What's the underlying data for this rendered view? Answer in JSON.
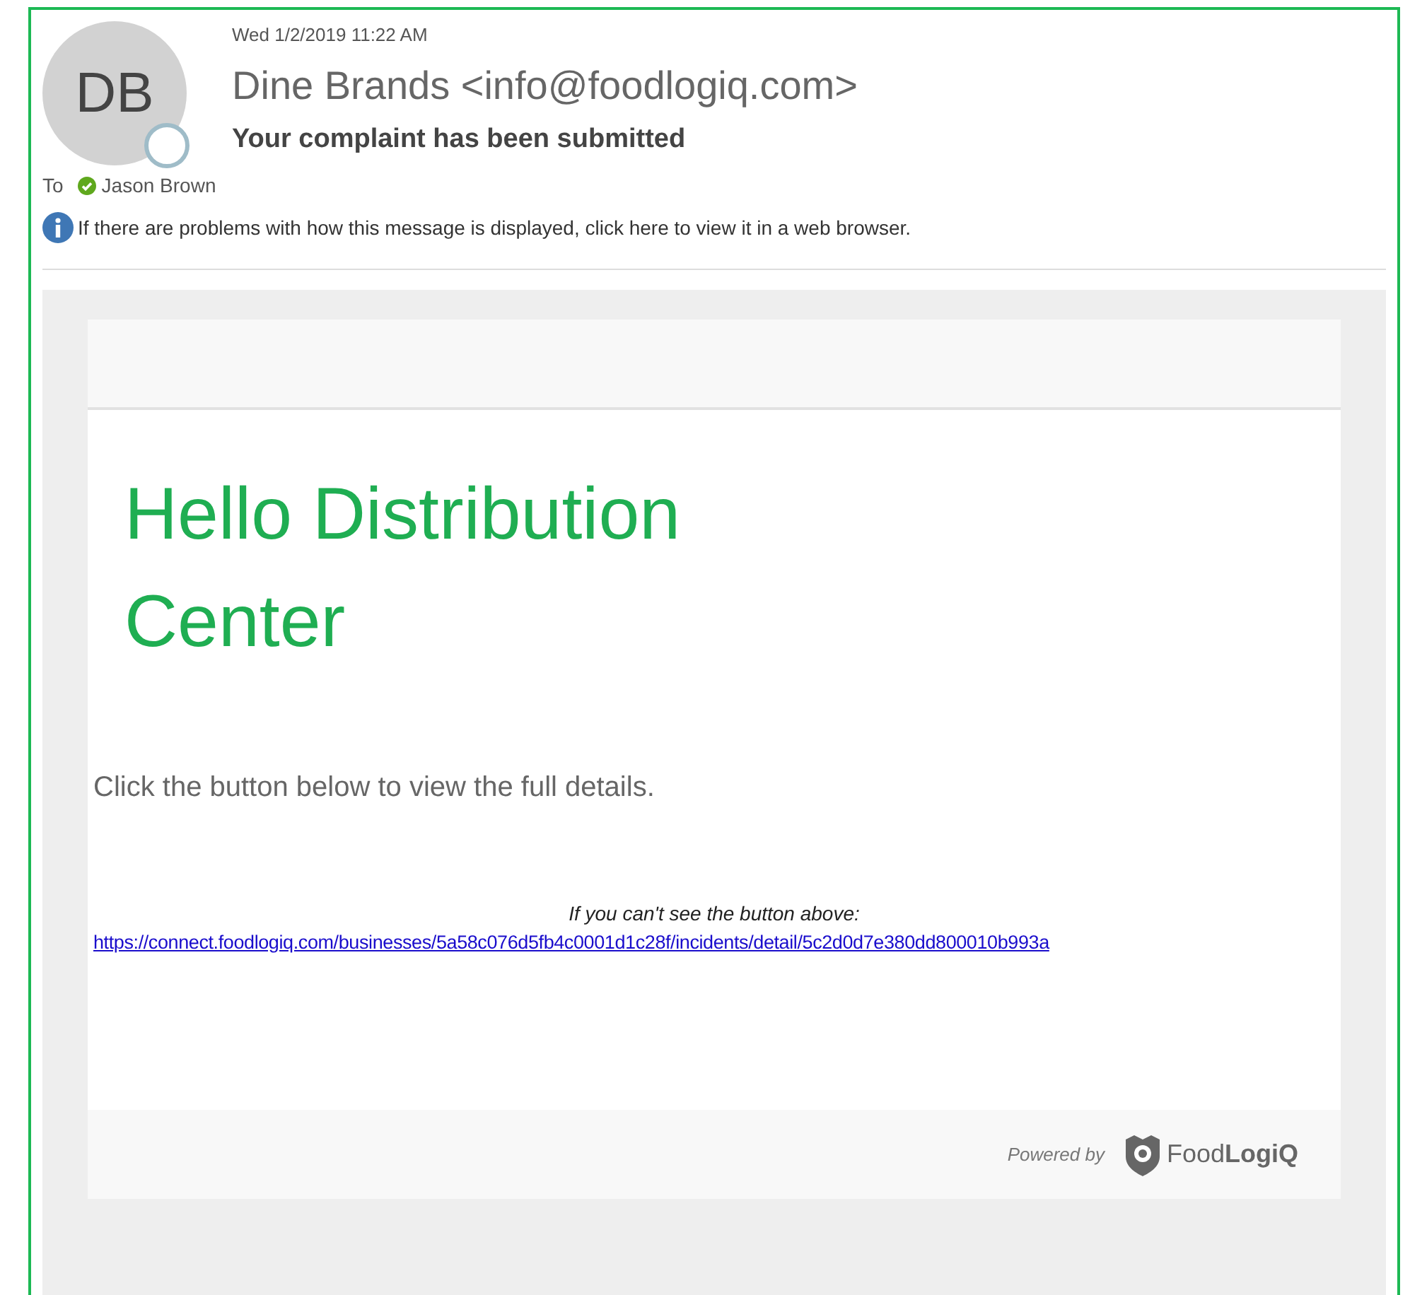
{
  "header": {
    "avatar_initials": "DB",
    "date": "Wed 1/2/2019 11:22 AM",
    "sender": "Dine Brands <info@foodlogiq.com>",
    "subject": "Your complaint has been submitted",
    "to_label": "To",
    "recipient": "Jason Brown",
    "info_bar": "If there are problems with how this message is displayed, click here to view it in a web browser."
  },
  "body": {
    "greeting": "Hello Distribution Center",
    "instruction": "Click the button below to view the full details.",
    "fallback_note": "If you can't see the button above:",
    "link": "https://connect.foodlogiq.com/businesses/5a58c076d5fb4c0001d1c28f/incidents/detail/5c2d0d7e380dd800010b993a"
  },
  "footer": {
    "powered_by": "Powered by",
    "brand": "Food**LogiQ**"
  }
}
